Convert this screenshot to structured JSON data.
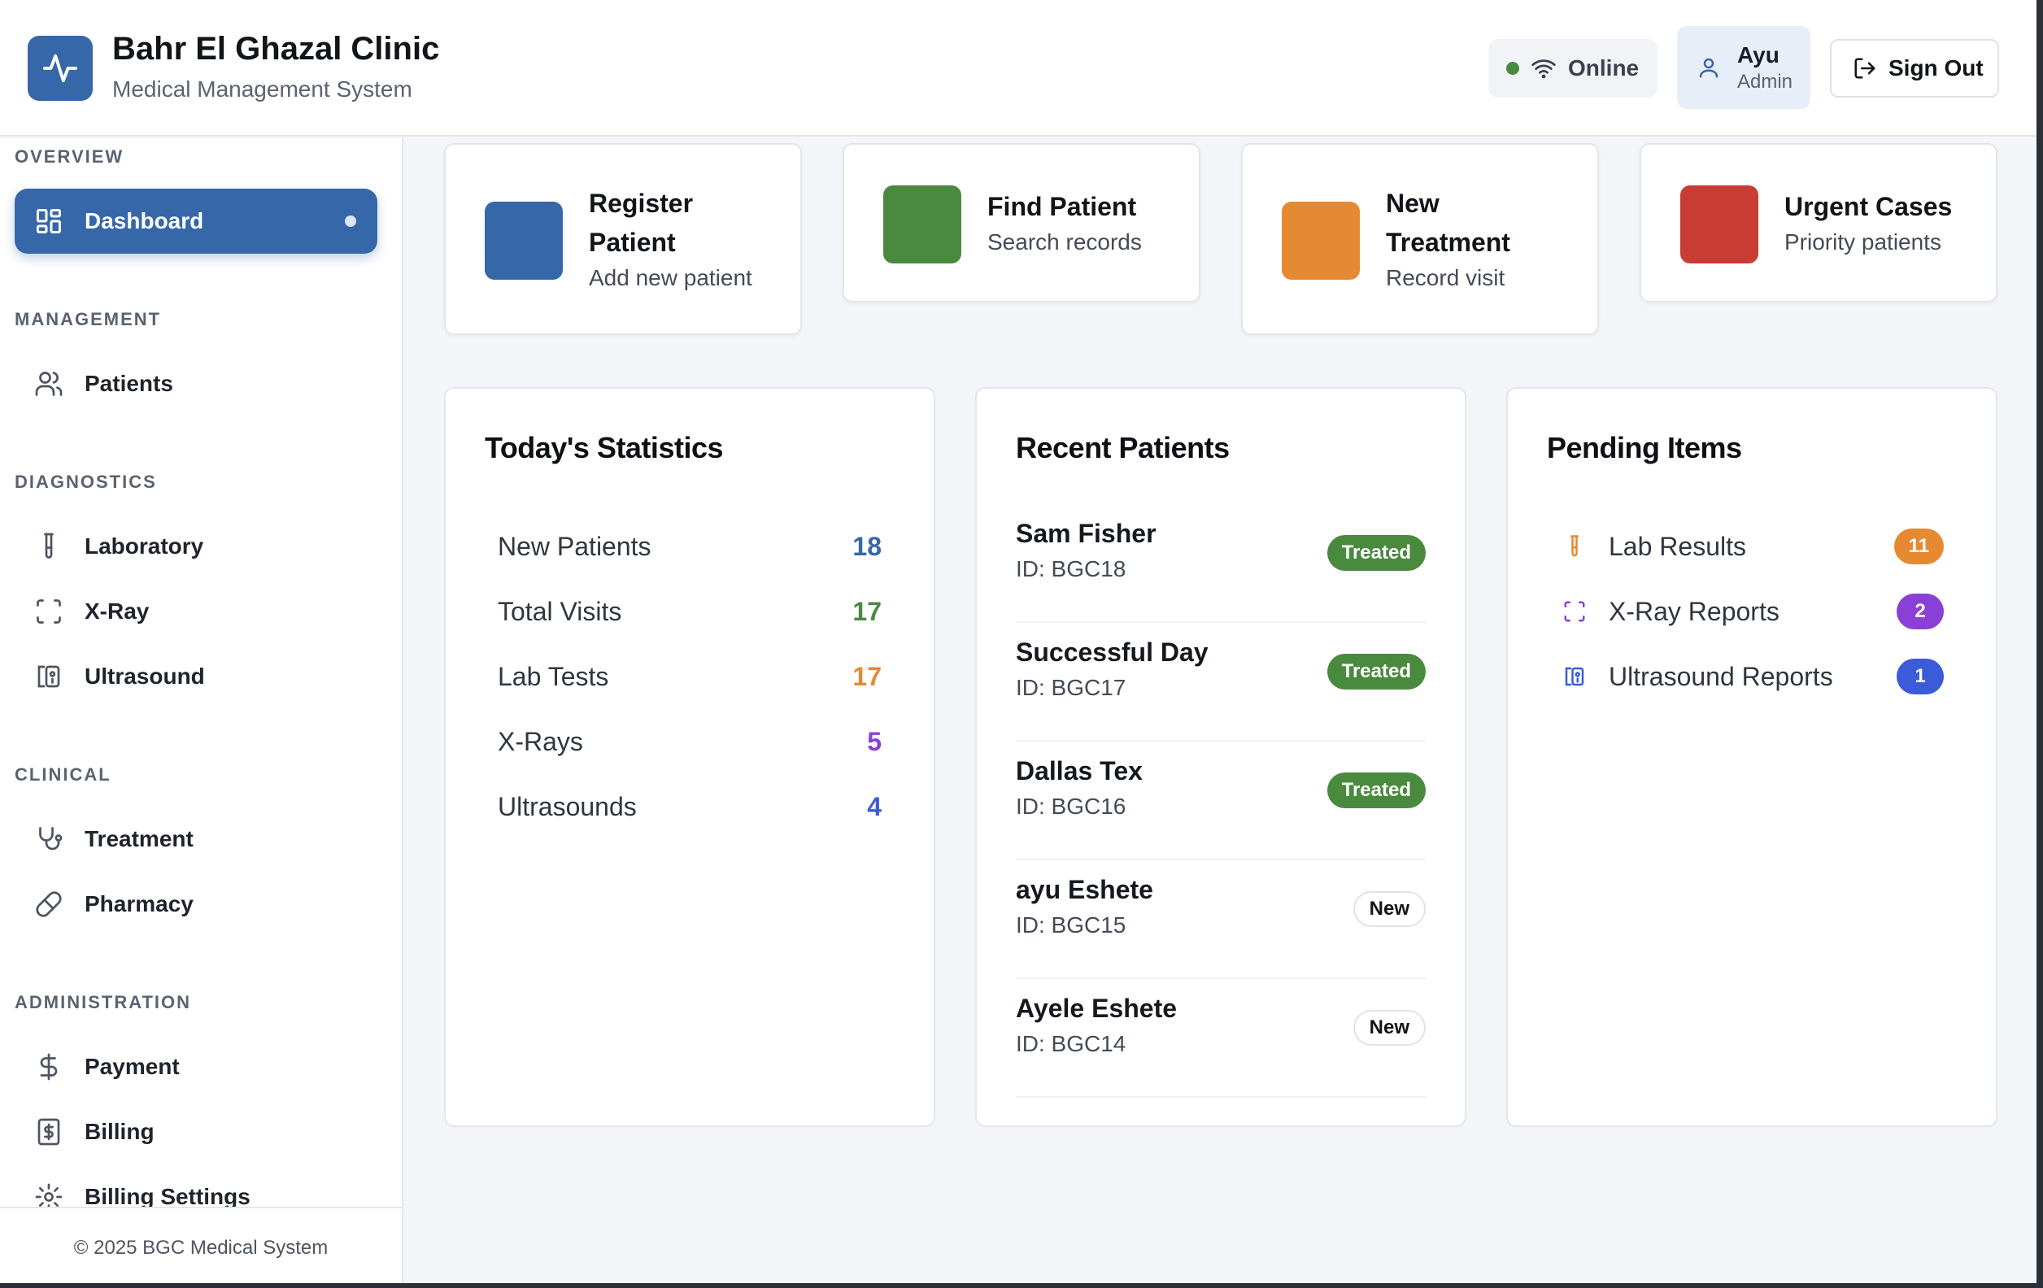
{
  "header": {
    "title": "Bahr El Ghazal Clinic",
    "subtitle": "Medical Management System",
    "status": "Online",
    "user": {
      "name": "Ayu",
      "role": "Admin"
    },
    "signout_label": "Sign Out"
  },
  "sidebar": {
    "sections": {
      "overview": "OVERVIEW",
      "management": "MANAGEMENT",
      "diagnostics": "DIAGNOSTICS",
      "clinical": "CLINICAL",
      "administration": "ADMINISTRATION"
    },
    "items": {
      "dashboard": "Dashboard",
      "patients": "Patients",
      "laboratory": "Laboratory",
      "xray": "X-Ray",
      "ultrasound": "Ultrasound",
      "treatment": "Treatment",
      "pharmacy": "Pharmacy",
      "payment": "Payment",
      "billing": "Billing",
      "billing_settings": "Billing Settings"
    },
    "footer": "© 2025 BGC Medical System"
  },
  "quick_actions": [
    {
      "title_line1": "Register",
      "title_line2": "Patient",
      "subtitle": "Add new patient",
      "color": "#3667a8"
    },
    {
      "title_line1": "Find Patient",
      "subtitle": "Search records",
      "color": "#4a8a3e"
    },
    {
      "title_line1": "New",
      "title_line2": "Treatment",
      "subtitle": "Record visit",
      "color": "#e58a32"
    },
    {
      "title_line1": "Urgent Cases",
      "subtitle": "Priority patients",
      "color": "#c93c34"
    }
  ],
  "stats": {
    "title": "Today's Statistics",
    "rows": [
      {
        "label": "New Patients",
        "value": "18",
        "color": "#3667a8"
      },
      {
        "label": "Total Visits",
        "value": "17",
        "color": "#4a8a3e"
      },
      {
        "label": "Lab Tests",
        "value": "17",
        "color": "#e58a32"
      },
      {
        "label": "X-Rays",
        "value": "5",
        "color": "#8a3fd6"
      },
      {
        "label": "Ultrasounds",
        "value": "4",
        "color": "#3b5bd8"
      }
    ]
  },
  "recent": {
    "title": "Recent Patients",
    "rows": [
      {
        "name": "Sam Fisher",
        "id": "ID: BGC18",
        "status": "Treated"
      },
      {
        "name": "Successful Day",
        "id": "ID: BGC17",
        "status": "Treated"
      },
      {
        "name": "Dallas Tex",
        "id": "ID: BGC16",
        "status": "Treated"
      },
      {
        "name": "ayu Eshete",
        "id": "ID: BGC15",
        "status": "New"
      },
      {
        "name": "Ayele Eshete",
        "id": "ID: BGC14",
        "status": "New"
      }
    ]
  },
  "pending": {
    "title": "Pending Items",
    "rows": [
      {
        "label": "Lab Results",
        "count": "11",
        "color": "#e58a32",
        "icon": "test-tube-icon"
      },
      {
        "label": "X-Ray Reports",
        "count": "2",
        "color": "#8a3fd6",
        "icon": "scan-icon"
      },
      {
        "label": "Ultrasound Reports",
        "count": "1",
        "color": "#3b5bd8",
        "icon": "ultrasound-icon"
      }
    ]
  }
}
